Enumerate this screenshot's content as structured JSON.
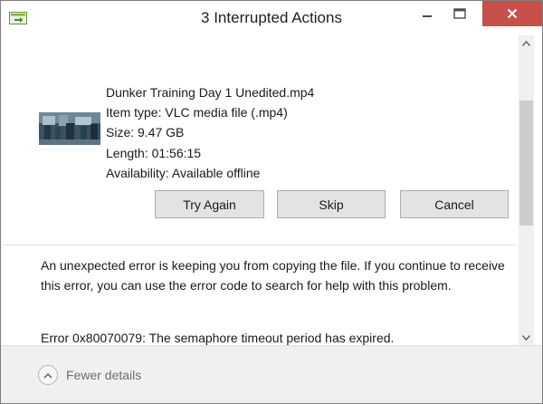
{
  "window": {
    "title": "3 Interrupted Actions",
    "close_color": "#c7504a"
  },
  "file": {
    "name": "Dunker Training Day 1 Unedited.mp4",
    "type": "Item type: VLC media file (.mp4)",
    "size": "Size: 9.47 GB",
    "length": "Length: 01:56:15",
    "availability": "Availability: Available offline",
    "thumbnail_icon": "video-thumbnail"
  },
  "buttons": {
    "try_again": "Try Again",
    "skip": "Skip",
    "cancel": "Cancel"
  },
  "message": {
    "body": "An unexpected error is keeping you from copying the file. If you continue to receive this error, you can use the error code to search for help with this problem.",
    "error": "Error 0x80070079: The semaphore timeout period has expired."
  },
  "footer": {
    "details_label": "Fewer details",
    "details_icon": "chevron-up-icon"
  }
}
